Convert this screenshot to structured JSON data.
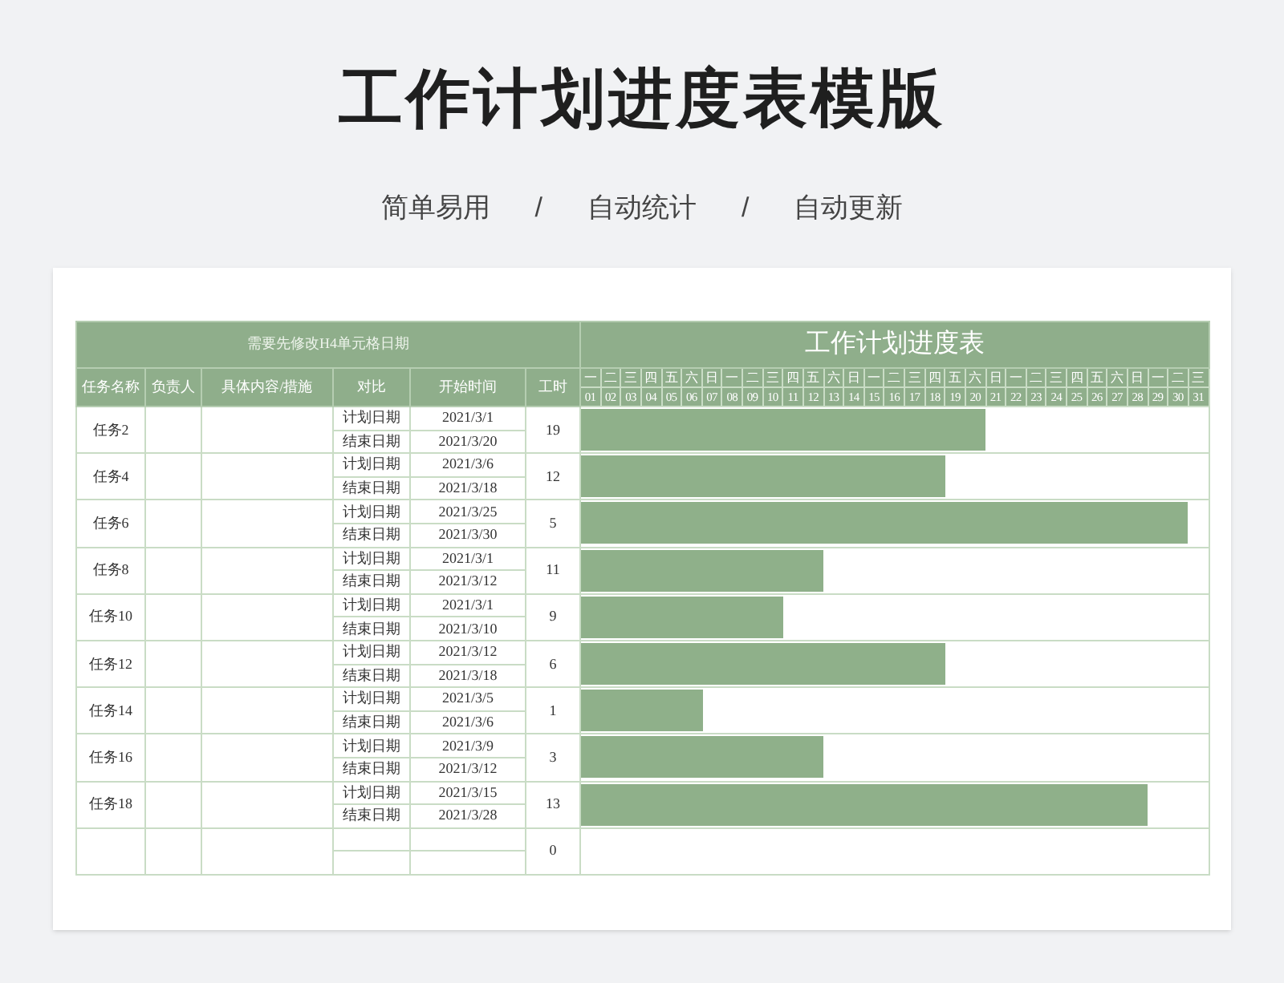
{
  "title": "工作计划进度表模版",
  "tagline": [
    "简单易用",
    "/",
    "自动统计",
    "/",
    "自动更新"
  ],
  "sheet": {
    "note": "需要先修改H4单元格日期",
    "chart_title": "工作计划进度表",
    "columns": [
      "任务名称",
      "负责人",
      "具体内容/措施",
      "对比",
      "开始时间",
      "工时"
    ],
    "weekdays": [
      "一",
      "二",
      "三",
      "四",
      "五",
      "六",
      "日",
      "一",
      "二",
      "三",
      "四",
      "五",
      "六",
      "日",
      "一",
      "二",
      "三",
      "四",
      "五",
      "六",
      "日",
      "一",
      "二",
      "三",
      "四",
      "五",
      "六",
      "日",
      "一",
      "二",
      "三"
    ],
    "dates": [
      "01",
      "02",
      "03",
      "04",
      "05",
      "06",
      "07",
      "08",
      "09",
      "10",
      "11",
      "12",
      "13",
      "14",
      "15",
      "16",
      "17",
      "18",
      "19",
      "20",
      "21",
      "22",
      "23",
      "24",
      "25",
      "26",
      "27",
      "28",
      "29",
      "30",
      "31"
    ],
    "tasks": [
      {
        "name": "任务2",
        "plan_label": "计划日期",
        "plan": "2021/3/1",
        "end_label": "结束日期",
        "end": "2021/3/20",
        "hours": "19",
        "level": 0.645
      },
      {
        "name": "任务4",
        "plan_label": "计划日期",
        "plan": "2021/3/6",
        "end_label": "结束日期",
        "end": "2021/3/18",
        "hours": "12",
        "level": 0.581
      },
      {
        "name": "任务6",
        "plan_label": "计划日期",
        "plan": "2021/3/25",
        "end_label": "结束日期",
        "end": "2021/3/30",
        "hours": "5",
        "level": 0.968
      },
      {
        "name": "任务8",
        "plan_label": "计划日期",
        "plan": "2021/3/1",
        "end_label": "结束日期",
        "end": "2021/3/12",
        "hours": "11",
        "level": 0.387
      },
      {
        "name": "任务10",
        "plan_label": "计划日期",
        "plan": "2021/3/1",
        "end_label": "结束日期",
        "end": "2021/3/10",
        "hours": "9",
        "level": 0.323
      },
      {
        "name": "任务12",
        "plan_label": "计划日期",
        "plan": "2021/3/12",
        "end_label": "结束日期",
        "end": "2021/3/18",
        "hours": "6",
        "level": 0.581
      },
      {
        "name": "任务14",
        "plan_label": "计划日期",
        "plan": "2021/3/5",
        "end_label": "结束日期",
        "end": "2021/3/6",
        "hours": "1",
        "level": 0.194
      },
      {
        "name": "任务16",
        "plan_label": "计划日期",
        "plan": "2021/3/9",
        "end_label": "结束日期",
        "end": "2021/3/12",
        "hours": "3",
        "level": 0.387
      },
      {
        "name": "任务18",
        "plan_label": "计划日期",
        "plan": "2021/3/15",
        "end_label": "结束日期",
        "end": "2021/3/28",
        "hours": "13",
        "level": 0.903
      },
      {
        "hours": "0"
      }
    ]
  }
}
